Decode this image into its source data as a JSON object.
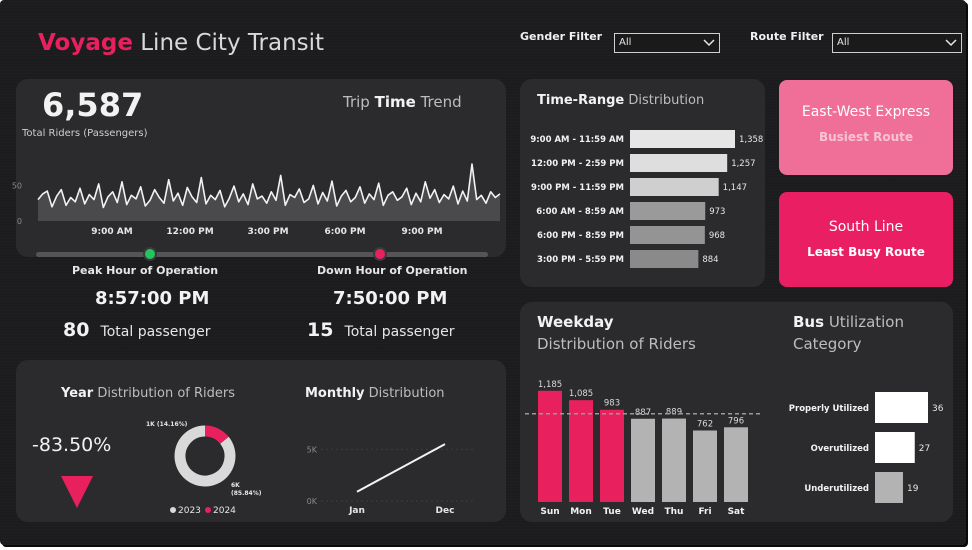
{
  "header": {
    "title_accent": "Voyage",
    "title_rest": "Line City Transit",
    "gender_filter": {
      "label": "Gender Filter",
      "value": "All"
    },
    "route_filter": {
      "label": "Route Filter",
      "value": "All"
    }
  },
  "colors": {
    "accent": "#e8205e",
    "card_light": "#ef6f98",
    "card_strong": "#ea1f63",
    "panel": "#2b2b2d",
    "background": "#1c1c1e"
  },
  "trend": {
    "total": "6,587",
    "total_label": "Total Riders (Passengers)",
    "title_a": "Trip",
    "title_b": "Time",
    "title_c": "Trend",
    "peak": {
      "label": "Peak Hour of Operation",
      "time": "8:57:00 PM",
      "count": "80",
      "count_label": "Total passenger"
    },
    "down": {
      "label": "Down Hour of Operation",
      "time": "7:50:00 PM",
      "count": "15",
      "count_label": "Total passenger"
    }
  },
  "time_range": {
    "title_a": "Time-Range",
    "title_b": "Distribution"
  },
  "cards": {
    "busiest": {
      "route": "East-West Express",
      "label": "Busiest Route"
    },
    "least": {
      "route": "South Line",
      "label": "Least Busy Route"
    }
  },
  "year": {
    "title_a": "Year",
    "title_b": "Distribution of Riders",
    "change": "-83.50%",
    "trend_icon": "down-triangle-icon"
  },
  "monthly": {
    "title_a": "Monthly",
    "title_b": "Distribution"
  },
  "weekday": {
    "title_a": "Weekday",
    "title_b": "Distribution of Riders"
  },
  "bus": {
    "title_a": "Bus",
    "title_b": "Utilization",
    "title_c": "Category"
  },
  "chart_data": [
    {
      "id": "trip_time_trend",
      "type": "area",
      "x_ticks": [
        "9:00 AM",
        "12:00 PM",
        "3:00 PM",
        "6:00 PM",
        "9:00 PM"
      ],
      "y_ticks": [
        "50",
        "0"
      ],
      "ylim": [
        0,
        80
      ],
      "values": [
        30,
        38,
        42,
        20,
        35,
        44,
        22,
        33,
        27,
        46,
        24,
        37,
        30,
        52,
        19,
        34,
        41,
        26,
        55,
        23,
        36,
        31,
        48,
        21,
        29,
        44,
        33,
        25,
        58,
        28,
        39,
        22,
        47,
        34,
        26,
        61,
        24,
        36,
        30,
        43,
        20,
        32,
        49,
        27,
        38,
        23,
        52,
        31,
        35,
        25,
        41,
        29,
        64,
        22,
        37,
        33,
        45,
        26,
        31,
        50,
        24,
        40,
        28,
        56,
        21,
        35,
        43,
        27,
        33,
        48,
        25,
        38,
        30,
        53,
        22,
        36,
        41,
        29,
        34,
        46,
        23,
        39,
        27,
        55,
        32,
        44,
        26,
        37,
        31,
        49,
        24,
        42,
        28,
        80,
        30,
        36,
        25,
        41,
        33,
        38
      ]
    },
    {
      "id": "time_range_distribution",
      "type": "bar",
      "orientation": "horizontal",
      "categories": [
        "9:00 AM - 11:59 AM",
        "12:00 PM - 2:59 PM",
        "9:00 PM - 11:59 PM",
        "6:00 AM - 8:59 AM",
        "6:00 PM - 8:59 PM",
        "3:00 PM - 5:59 PM"
      ],
      "values": [
        1358,
        1257,
        1147,
        973,
        968,
        884
      ],
      "labels": [
        "1,358",
        "1,257",
        "1,147",
        "973",
        "968",
        "884"
      ]
    },
    {
      "id": "year_distribution",
      "type": "pie",
      "categories": [
        "2023",
        "2024"
      ],
      "values": [
        85.84,
        14.16
      ],
      "labels": [
        "6K (85.84%)",
        "1K (14.16%)"
      ],
      "colors": [
        "#d9d9d9",
        "#e8205e"
      ]
    },
    {
      "id": "monthly_distribution",
      "type": "line",
      "categories": [
        "Jan",
        "Dec"
      ],
      "values": [
        900,
        5500
      ],
      "y_ticks": [
        "5K",
        "0K"
      ],
      "ylim": [
        0,
        6000
      ]
    },
    {
      "id": "weekday_distribution",
      "type": "bar",
      "categories": [
        "Sun",
        "Mon",
        "Tue",
        "Wed",
        "Thu",
        "Fri",
        "Sat"
      ],
      "values": [
        1185,
        1085,
        983,
        887,
        889,
        762,
        796
      ],
      "labels": [
        "1,185",
        "1,085",
        "983",
        "887",
        "889",
        "762",
        "796"
      ],
      "average": 941,
      "ylim": [
        0,
        1300
      ]
    },
    {
      "id": "bus_utilization",
      "type": "bar",
      "orientation": "horizontal",
      "categories": [
        "Properly Utilized",
        "Overutilized",
        "Underutilized"
      ],
      "values": [
        36,
        27,
        19
      ],
      "labels": [
        "36",
        "27",
        "19"
      ]
    }
  ]
}
